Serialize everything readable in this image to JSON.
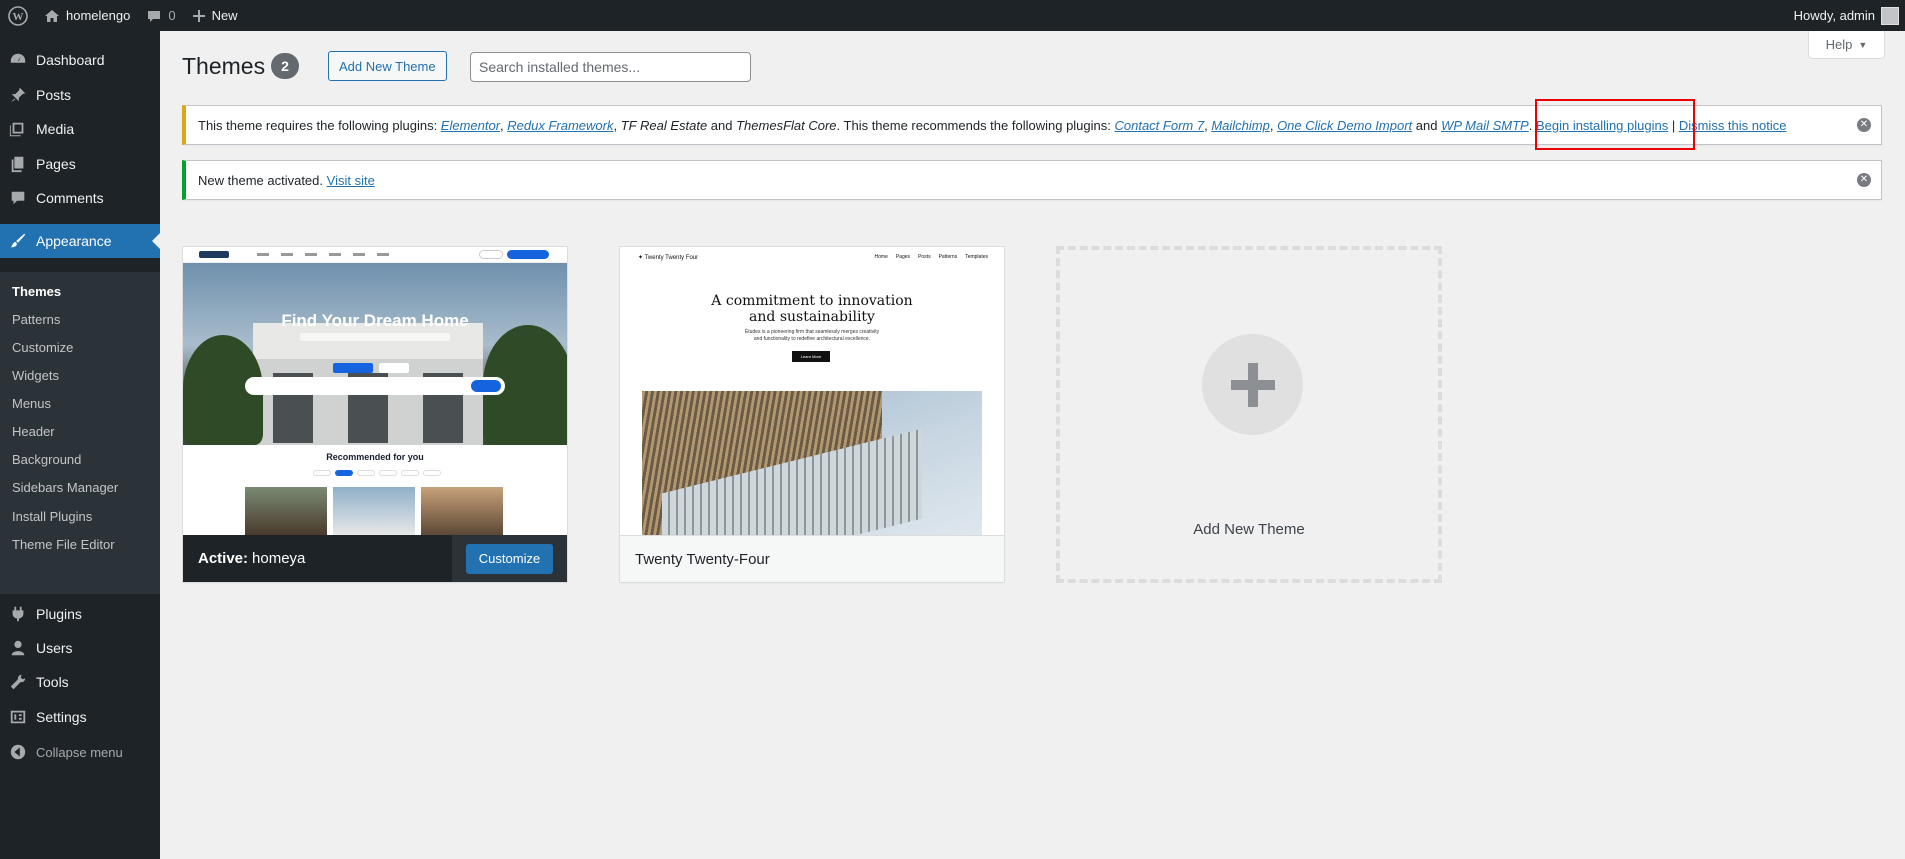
{
  "adminbar": {
    "site_name": "homelengo",
    "comments_count": "0",
    "new_label": "New",
    "howdy": "Howdy, admin"
  },
  "sidebar": {
    "items": [
      {
        "label": "Dashboard",
        "icon": "dashboard-icon"
      },
      {
        "label": "Posts",
        "icon": "pin-icon"
      },
      {
        "label": "Media",
        "icon": "media-icon"
      },
      {
        "label": "Pages",
        "icon": "pages-icon"
      },
      {
        "label": "Comments",
        "icon": "comment-icon"
      },
      {
        "label": "Appearance",
        "icon": "brush-icon"
      },
      {
        "label": "Plugins",
        "icon": "plugin-icon"
      },
      {
        "label": "Users",
        "icon": "users-icon"
      },
      {
        "label": "Tools",
        "icon": "wrench-icon"
      },
      {
        "label": "Settings",
        "icon": "settings-icon"
      }
    ],
    "appearance_submenu": [
      "Themes",
      "Patterns",
      "Customize",
      "Widgets",
      "Menus",
      "Header",
      "Background",
      "Sidebars Manager",
      "Install Plugins",
      "Theme File Editor"
    ],
    "collapse_label": "Collapse menu"
  },
  "header": {
    "title": "Themes",
    "count": "2",
    "add_new_label": "Add New Theme",
    "search_placeholder": "Search installed themes...",
    "help_label": "Help"
  },
  "notices": {
    "plugins": {
      "intro": "This theme requires the following plugins: ",
      "req1": "Elementor",
      "sep1": ", ",
      "req2": "Redux Framework",
      "sep2": ", ",
      "req3": "TF Real Estate",
      "and1": " and ",
      "req4": "ThemesFlat Core",
      "mid": ". This theme recommends the following plugins: ",
      "rec1": "Contact Form 7",
      "sep3": ", ",
      "rec2": "Mailchimp",
      "sep4": ", ",
      "rec3": "One Click Demo Import",
      "and2": " and ",
      "rec4": "WP Mail SMTP",
      "dot": ". ",
      "begin": "Begin installing plugins",
      "pipe": " | ",
      "dismiss": "Dismiss this notice"
    },
    "activated": {
      "text": "New theme activated. ",
      "link": "Visit site"
    }
  },
  "themes": {
    "active": {
      "active_label": "Active:",
      "name": "homeya",
      "customize_label": "Customize",
      "hero_title": "Find Your Dream Home",
      "recommended": "Recommended for you"
    },
    "second": {
      "name": "Twenty Twenty-Four",
      "brand": "Twenty Twenty Four",
      "nav": [
        "Home",
        "Pages",
        "Posts",
        "Patterns",
        "Templates"
      ],
      "headline_1": "A commitment to innovation",
      "headline_2": "and sustainability",
      "para_1": "Études is a pioneering firm that seamlessly merges creativity",
      "para_2": "and functionality to redefine architectural excellence.",
      "button": "Learn More"
    },
    "add_new_label": "Add New Theme"
  },
  "colors": {
    "accent": "#2271b1",
    "adminbar": "#1d2327",
    "warning": "#dba617",
    "success": "#00a32a",
    "highlight": "#ee0000"
  }
}
